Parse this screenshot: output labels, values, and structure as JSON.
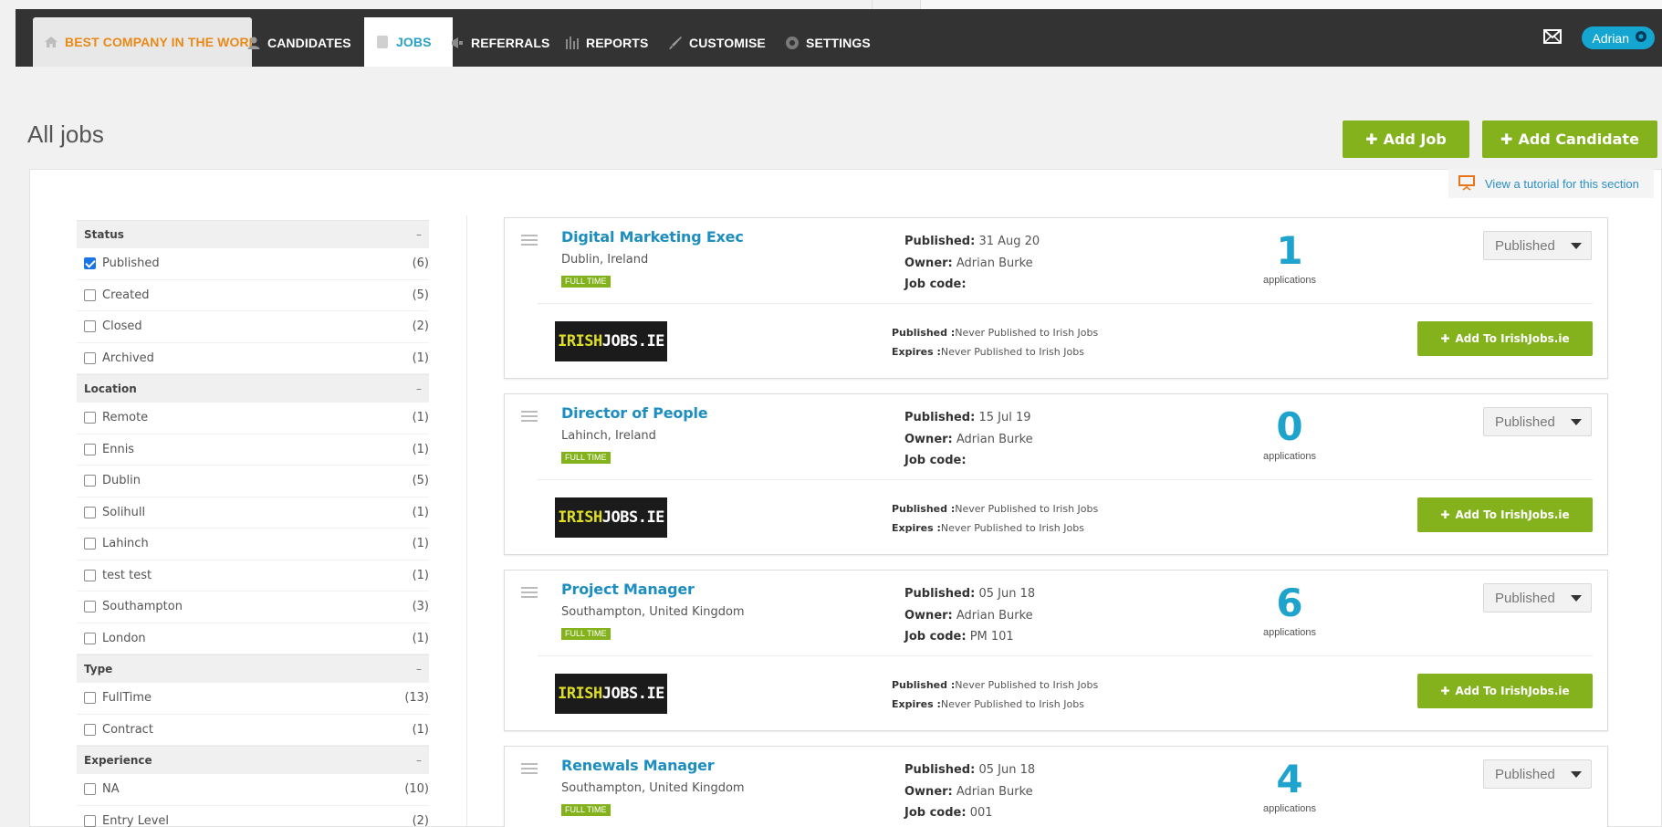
{
  "nav": {
    "company": "BEST COMPANY IN THE WORLD",
    "items": [
      {
        "label": "CANDIDATES",
        "icon": "person-icon"
      },
      {
        "label": "JOBS",
        "icon": "document-icon"
      },
      {
        "label": "REFERRALS",
        "icon": "megaphone-icon"
      },
      {
        "label": "REPORTS",
        "icon": "bar-chart-icon"
      },
      {
        "label": "CUSTOMISE",
        "icon": "brush-icon"
      },
      {
        "label": "SETTINGS",
        "icon": "gear-icon"
      }
    ],
    "user": "Adrian"
  },
  "page": {
    "title": "All jobs",
    "add_job": "Add Job",
    "add_candidate": "Add Candidate",
    "tutorial": "View a tutorial for this section"
  },
  "filters": {
    "status": {
      "title": "Status",
      "items": [
        {
          "label": "Published",
          "count": "(6)",
          "checked": true
        },
        {
          "label": "Created",
          "count": "(5)"
        },
        {
          "label": "Closed",
          "count": "(2)"
        },
        {
          "label": "Archived",
          "count": "(1)"
        }
      ]
    },
    "location": {
      "title": "Location",
      "items": [
        {
          "label": "Remote",
          "count": "(1)"
        },
        {
          "label": "Ennis",
          "count": "(1)"
        },
        {
          "label": "Dublin",
          "count": "(5)"
        },
        {
          "label": "Solihull",
          "count": "(1)"
        },
        {
          "label": "Lahinch",
          "count": "(1)"
        },
        {
          "label": "test test",
          "count": "(1)"
        },
        {
          "label": "Southampton",
          "count": "(3)"
        },
        {
          "label": "London",
          "count": "(1)"
        }
      ]
    },
    "type": {
      "title": "Type",
      "items": [
        {
          "label": "FullTime",
          "count": "(13)"
        },
        {
          "label": "Contract",
          "count": "(1)"
        }
      ]
    },
    "experience": {
      "title": "Experience",
      "items": [
        {
          "label": "NA",
          "count": "(10)"
        },
        {
          "label": "Entry Level",
          "count": "(2)"
        }
      ]
    },
    "collapse_symbol": "–"
  },
  "jobs": [
    {
      "title": "Digital Marketing Exec",
      "location": "Dublin, Ireland",
      "badge": "FULL TIME",
      "published_label": "Published:",
      "published": "31 Aug 20",
      "owner_label": "Owner:",
      "owner": "Adrian Burke",
      "code_label": "Job code:",
      "code": "",
      "count": "1",
      "count_label": "applications",
      "status": "Published",
      "board_published": "Never Published to Irish Jobs",
      "board_expires": "Never Published to Irish Jobs",
      "add_board": "Add To IrishJobs.ie"
    },
    {
      "title": "Director of People",
      "location": "Lahinch, Ireland",
      "badge": "FULL TIME",
      "published_label": "Published:",
      "published": "15 Jul 19",
      "owner_label": "Owner:",
      "owner": "Adrian Burke",
      "code_label": "Job code:",
      "code": "",
      "count": "0",
      "count_label": "applications",
      "status": "Published",
      "board_published": "Never Published to Irish Jobs",
      "board_expires": "Never Published to Irish Jobs",
      "add_board": "Add To IrishJobs.ie"
    },
    {
      "title": "Project Manager",
      "location": "Southampton, United Kingdom",
      "badge": "FULL TIME",
      "published_label": "Published:",
      "published": "05 Jun 18",
      "owner_label": "Owner:",
      "owner": "Adrian Burke",
      "code_label": "Job code:",
      "code": "PM 101",
      "count": "6",
      "count_label": "applications",
      "status": "Published",
      "board_published": "Never Published to Irish Jobs",
      "board_expires": "Never Published to Irish Jobs",
      "add_board": "Add To IrishJobs.ie"
    },
    {
      "title": "Renewals Manager",
      "location": "Southampton, United Kingdom",
      "badge": "FULL TIME",
      "published_label": "Published:",
      "published": "05 Jun 18",
      "owner_label": "Owner:",
      "owner": "Adrian Burke",
      "code_label": "Job code:",
      "code": "001",
      "count": "4",
      "count_label": "applications",
      "status": "Published",
      "board_published": "Never Published to Irish Jobs",
      "board_expires": "Never Published to Irish Jobs",
      "add_board": "Add To IrishJobs.ie"
    }
  ],
  "board": {
    "logo_part1": "IRISH",
    "logo_part2": "JOBS.IE",
    "published_label": "Published :",
    "expires_label": "Expires :"
  },
  "colors": {
    "nav_bg": "#333333",
    "accent_green": "#84b21c",
    "link_blue": "#1e8ec0",
    "count_blue": "#1ea3cc",
    "company_orange": "#e98a18"
  }
}
